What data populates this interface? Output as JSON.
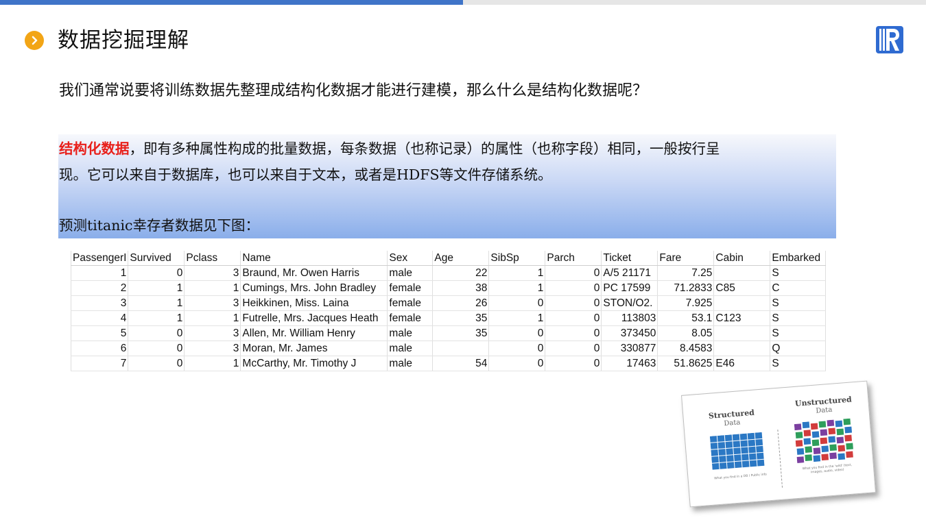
{
  "header": {
    "title": "数据挖掘理解"
  },
  "intro_text": "我们通常说要将训练数据先整理成结构化数据才能进行建模，那么什么是结构化数据呢？",
  "definition": {
    "term": "结构化数据",
    "line1_rest": "，即有多种属性构成的批量数据，每条数据（也称记录）的属性（也称字段）相同，一般按行呈",
    "line2": "现。它可以来自于数据库，也可以来自于文本，或者是HDFS等文件存储系统。"
  },
  "predict_text": "预测titanic幸存者数据见下图：",
  "table": {
    "headers": [
      "PassengerI",
      "Survived",
      "Pclass",
      "Name",
      "Sex",
      "Age",
      "SibSp",
      "Parch",
      "Ticket",
      "Fare",
      "Cabin",
      "Embarked"
    ],
    "rows": [
      [
        "1",
        "0",
        "3",
        "Braund, Mr. Owen Harris",
        "male",
        "22",
        "1",
        "0",
        "A/5 21171",
        "7.25",
        "",
        "S"
      ],
      [
        "2",
        "1",
        "1",
        "Cumings, Mrs. John Bradley",
        "female",
        "38",
        "1",
        "0",
        "PC 17599",
        "71.2833",
        "C85",
        "C"
      ],
      [
        "3",
        "1",
        "3",
        "Heikkinen, Miss. Laina",
        "female",
        "26",
        "0",
        "0",
        "STON/O2.",
        "7.925",
        "",
        "S"
      ],
      [
        "4",
        "1",
        "1",
        "Futrelle, Mrs. Jacques Heath",
        "female",
        "35",
        "1",
        "0",
        "113803",
        "53.1",
        "C123",
        "S"
      ],
      [
        "5",
        "0",
        "3",
        "Allen, Mr. William Henry",
        "male",
        "35",
        "0",
        "0",
        "373450",
        "8.05",
        "",
        "S"
      ],
      [
        "6",
        "0",
        "3",
        "Moran, Mr. James",
        "male",
        "",
        "0",
        "0",
        "330877",
        "8.4583",
        "",
        "Q"
      ],
      [
        "7",
        "0",
        "1",
        "McCarthy, Mr. Timothy J",
        "male",
        "54",
        "0",
        "0",
        "17463",
        "51.8625",
        "E46",
        "S"
      ]
    ]
  },
  "illustration": {
    "left_title": "Structured",
    "left_sub": "Data",
    "left_caption": "What you find in a DB / Public info",
    "right_title": "Unstructured",
    "right_sub": "Data",
    "right_caption": "What you find in the 'wild' (text, images, audio, video)"
  },
  "colors": {
    "accent_bar": "#3f74c8",
    "title_icon": "#f2a516",
    "term_red": "#e8201b",
    "logo_blue": "#2f6bd1"
  },
  "icons": {
    "title_icon": "chevron-right-circle-icon",
    "logo": "r-logo-icon"
  }
}
